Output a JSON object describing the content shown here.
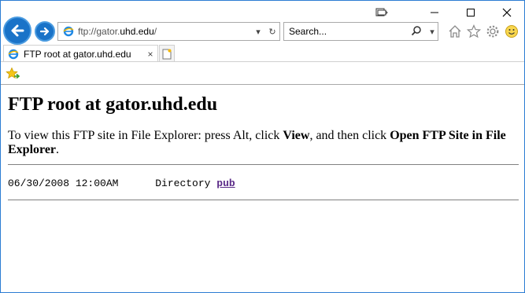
{
  "browser": {
    "address_url_prefix": "ftp://gator.",
    "address_url_domain": "uhd.edu",
    "address_url_suffix": "/",
    "search_placeholder": "Search...",
    "tab_title": "FTP root at gator.uhd.edu",
    "tab_close_glyph": "×",
    "icons": {
      "back": "back-arrow-icon",
      "forward": "forward-arrow-icon",
      "compat": "compatibility-view-icon",
      "minimize": "minimize-icon",
      "maximize": "maximize-icon",
      "close": "close-icon",
      "home": "home-icon",
      "favorites": "favorites-star-icon",
      "settings": "gear-icon",
      "feedback": "smiley-icon"
    }
  },
  "page": {
    "heading": "FTP root at gator.uhd.edu",
    "instruction_pre": "To view this FTP site in File Explorer: press Alt, click ",
    "instruction_view": "View",
    "instruction_mid": ", and then click ",
    "instruction_open": "Open FTP Site in File Explorer",
    "instruction_end": ".",
    "listing": [
      {
        "date": "06/30/2008",
        "time": "12:00AM",
        "type": "Directory",
        "name": "pub"
      }
    ]
  }
}
